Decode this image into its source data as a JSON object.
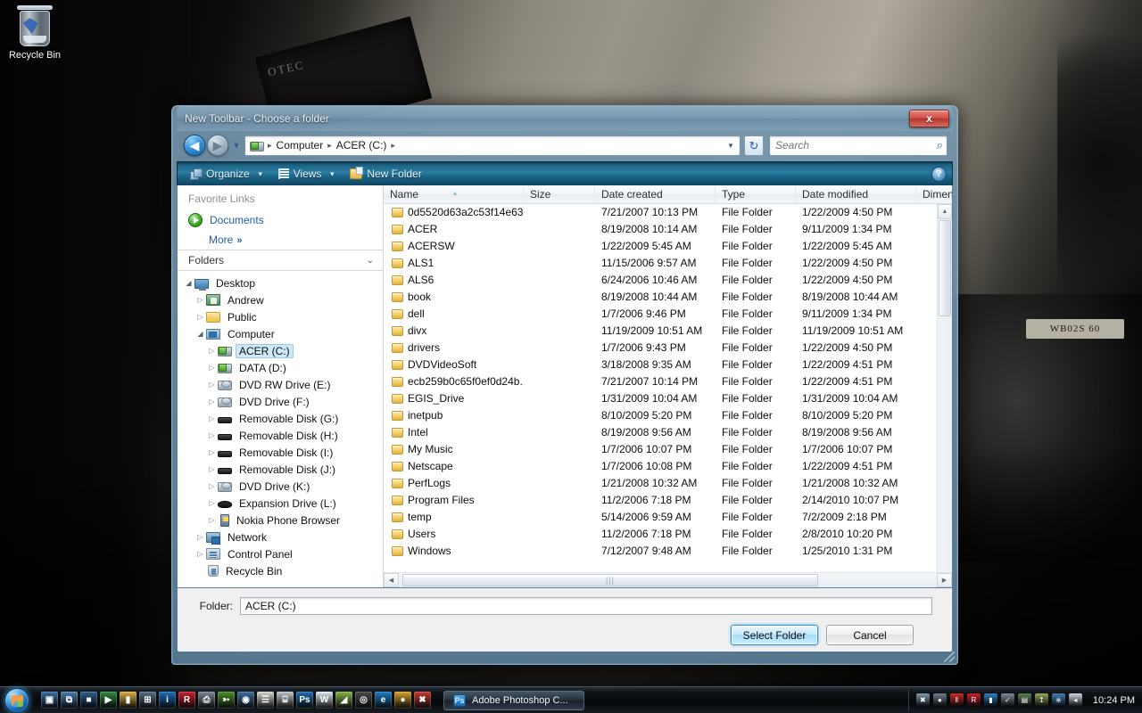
{
  "desktop": {
    "recycle_bin_label": "Recycle Bin",
    "wallpaper_plate_text": "WB02S 60",
    "wallpaper_sign_text": "OTEC"
  },
  "dialog": {
    "title": "New Toolbar - Choose a folder",
    "close_label": "x",
    "nav": {
      "back_icon": "◀",
      "forward_icon": "▶",
      "history_caret": "▼",
      "address_drive_icon": "hdd-icon",
      "breadcrumbs": [
        "Computer",
        "ACER (C:)"
      ],
      "breadcrumb_sep": "▸",
      "address_dropdown_caret": "▼",
      "refresh_icon": "↻",
      "search_placeholder": "Search",
      "search_value": "",
      "search_icon": "⌕"
    },
    "toolbar": {
      "organize_label": "Organize",
      "views_label": "Views",
      "new_folder_label": "New Folder",
      "caret": "▼",
      "help_label": "?"
    },
    "navpane": {
      "favorites_header": "Favorite Links",
      "favorites": [
        {
          "label": "Documents",
          "icon": "documents-green-icon"
        }
      ],
      "more_label": "More",
      "more_chevron": "»",
      "folders_header": "Folders",
      "folders_chevron": "⌄",
      "tree": [
        {
          "label": "Desktop",
          "depth": 0,
          "arrow": "open",
          "icon": "monitor-icon",
          "selected": false
        },
        {
          "label": "Andrew",
          "depth": 1,
          "arrow": "closed",
          "icon": "user-folder-icon",
          "selected": false
        },
        {
          "label": "Public",
          "depth": 1,
          "arrow": "closed",
          "icon": "folder-icon",
          "selected": false
        },
        {
          "label": "Computer",
          "depth": 1,
          "arrow": "open",
          "icon": "computer-icon",
          "selected": false
        },
        {
          "label": "ACER (C:)",
          "depth": 2,
          "arrow": "closed",
          "icon": "harddisk-icon",
          "selected": true
        },
        {
          "label": "DATA (D:)",
          "depth": 2,
          "arrow": "closed",
          "icon": "harddisk-icon",
          "selected": false
        },
        {
          "label": "DVD RW Drive (E:)",
          "depth": 2,
          "arrow": "closed",
          "icon": "dvd-drive-icon",
          "selected": false
        },
        {
          "label": "DVD Drive (F:)",
          "depth": 2,
          "arrow": "closed",
          "icon": "dvd-drive-icon",
          "selected": false
        },
        {
          "label": "Removable Disk (G:)",
          "depth": 2,
          "arrow": "closed",
          "icon": "removable-disk-icon",
          "selected": false
        },
        {
          "label": "Removable Disk (H:)",
          "depth": 2,
          "arrow": "closed",
          "icon": "removable-disk-icon",
          "selected": false
        },
        {
          "label": "Removable Disk (I:)",
          "depth": 2,
          "arrow": "closed",
          "icon": "removable-disk-icon",
          "selected": false
        },
        {
          "label": "Removable Disk (J:)",
          "depth": 2,
          "arrow": "closed",
          "icon": "removable-disk-icon",
          "selected": false
        },
        {
          "label": "DVD Drive (K:)",
          "depth": 2,
          "arrow": "closed",
          "icon": "dvd-drive-icon",
          "selected": false
        },
        {
          "label": "Expansion Drive (L:)",
          "depth": 2,
          "arrow": "closed",
          "icon": "expansion-drive-icon",
          "selected": false
        },
        {
          "label": "Nokia Phone Browser",
          "depth": 2,
          "arrow": "closed",
          "icon": "phone-icon",
          "selected": false
        },
        {
          "label": "Network",
          "depth": 1,
          "arrow": "closed",
          "icon": "network-icon",
          "selected": false
        },
        {
          "label": "Control Panel",
          "depth": 1,
          "arrow": "closed",
          "icon": "control-panel-icon",
          "selected": false
        },
        {
          "label": "Recycle Bin",
          "depth": 1,
          "arrow": "none",
          "icon": "recycle-bin-icon",
          "selected": false
        }
      ]
    },
    "filelist": {
      "columns": [
        {
          "label": "Name",
          "width": 157,
          "sorted": true
        },
        {
          "label": "Size",
          "width": 80,
          "sorted": false
        },
        {
          "label": "Date created",
          "width": 135,
          "sorted": false
        },
        {
          "label": "Type",
          "width": 90,
          "sorted": false
        },
        {
          "label": "Date modified",
          "width": 135,
          "sorted": false
        },
        {
          "label": "Dimen",
          "width": 45,
          "sorted": false
        }
      ],
      "sort_marker": "▴",
      "rows": [
        {
          "name": "0d5520d63a2c53f14e63...",
          "size": "",
          "created": "7/21/2007 10:13 PM",
          "type": "File Folder",
          "modified": "1/22/2009 4:50 PM",
          "dimensions": ""
        },
        {
          "name": "ACER",
          "size": "",
          "created": "8/19/2008 10:14 AM",
          "type": "File Folder",
          "modified": "9/11/2009 1:34 PM",
          "dimensions": ""
        },
        {
          "name": "ACERSW",
          "size": "",
          "created": "1/22/2009 5:45 AM",
          "type": "File Folder",
          "modified": "1/22/2009 5:45 AM",
          "dimensions": ""
        },
        {
          "name": "ALS1",
          "size": "",
          "created": "11/15/2006 9:57 AM",
          "type": "File Folder",
          "modified": "1/22/2009 4:50 PM",
          "dimensions": ""
        },
        {
          "name": "ALS6",
          "size": "",
          "created": "6/24/2006 10:46 AM",
          "type": "File Folder",
          "modified": "1/22/2009 4:50 PM",
          "dimensions": ""
        },
        {
          "name": "book",
          "size": "",
          "created": "8/19/2008 10:44 AM",
          "type": "File Folder",
          "modified": "8/19/2008 10:44 AM",
          "dimensions": ""
        },
        {
          "name": "dell",
          "size": "",
          "created": "1/7/2006 9:46 PM",
          "type": "File Folder",
          "modified": "9/11/2009 1:34 PM",
          "dimensions": ""
        },
        {
          "name": "divx",
          "size": "",
          "created": "11/19/2009 10:51 AM",
          "type": "File Folder",
          "modified": "11/19/2009 10:51 AM",
          "dimensions": ""
        },
        {
          "name": "drivers",
          "size": "",
          "created": "1/7/2006 9:43 PM",
          "type": "File Folder",
          "modified": "1/22/2009 4:50 PM",
          "dimensions": ""
        },
        {
          "name": "DVDVideoSoft",
          "size": "",
          "created": "3/18/2008 9:35 AM",
          "type": "File Folder",
          "modified": "1/22/2009 4:51 PM",
          "dimensions": ""
        },
        {
          "name": "ecb259b0c65f0ef0d24b...",
          "size": "",
          "created": "7/21/2007 10:14 PM",
          "type": "File Folder",
          "modified": "1/22/2009 4:51 PM",
          "dimensions": ""
        },
        {
          "name": "EGIS_Drive",
          "size": "",
          "created": "1/31/2009 10:04 AM",
          "type": "File Folder",
          "modified": "1/31/2009 10:04 AM",
          "dimensions": ""
        },
        {
          "name": "inetpub",
          "size": "",
          "created": "8/10/2009 5:20 PM",
          "type": "File Folder",
          "modified": "8/10/2009 5:20 PM",
          "dimensions": ""
        },
        {
          "name": "Intel",
          "size": "",
          "created": "8/19/2008 9:56 AM",
          "type": "File Folder",
          "modified": "8/19/2008 9:56 AM",
          "dimensions": ""
        },
        {
          "name": "My Music",
          "size": "",
          "created": "1/7/2006 10:07 PM",
          "type": "File Folder",
          "modified": "1/7/2006 10:07 PM",
          "dimensions": ""
        },
        {
          "name": "Netscape",
          "size": "",
          "created": "1/7/2006 10:08 PM",
          "type": "File Folder",
          "modified": "1/22/2009 4:51 PM",
          "dimensions": ""
        },
        {
          "name": "PerfLogs",
          "size": "",
          "created": "1/21/2008 10:32 AM",
          "type": "File Folder",
          "modified": "1/21/2008 10:32 AM",
          "dimensions": ""
        },
        {
          "name": "Program Files",
          "size": "",
          "created": "11/2/2006 7:18 PM",
          "type": "File Folder",
          "modified": "2/14/2010 10:07 PM",
          "dimensions": ""
        },
        {
          "name": "temp",
          "size": "",
          "created": "5/14/2006 9:59 AM",
          "type": "File Folder",
          "modified": "7/2/2009 2:18 PM",
          "dimensions": ""
        },
        {
          "name": "Users",
          "size": "",
          "created": "11/2/2006 7:18 PM",
          "type": "File Folder",
          "modified": "2/8/2010 10:20 PM",
          "dimensions": ""
        },
        {
          "name": "Windows",
          "size": "",
          "created": "7/12/2007 9:48 AM",
          "type": "File Folder",
          "modified": "1/25/2010 1:31 PM",
          "dimensions": ""
        }
      ],
      "hscroll_left_arrow": "◀",
      "hscroll_right_arrow": "▶",
      "hscroll_grip": "|||",
      "vscroll_up_arrow": "▲",
      "vscroll_down_arrow": "▼"
    },
    "footer": {
      "folder_label": "Folder:",
      "folder_value": "ACER (C:)",
      "select_folder_label": "Select Folder",
      "cancel_label": "Cancel"
    }
  },
  "taskbar": {
    "start_label": "Start",
    "quick_launch": [
      {
        "name": "show-desktop-icon",
        "color": "#3a6ea5",
        "glyph": "▣"
      },
      {
        "name": "switch-windows-icon",
        "color": "#4b7fae",
        "glyph": "⧉"
      },
      {
        "name": "media-center-icon",
        "color": "#2f5f8f",
        "glyph": "■"
      },
      {
        "name": "media-player-icon",
        "color": "#2e8b3e",
        "glyph": "▶"
      },
      {
        "name": "folder-icon",
        "color": "#e0b244",
        "glyph": "▮"
      },
      {
        "name": "calculator-icon",
        "color": "#5a6f86",
        "glyph": "⊞"
      },
      {
        "name": "info-icon",
        "color": "#1e6fb8",
        "glyph": "i"
      },
      {
        "name": "avira-icon",
        "color": "#cf1f2d",
        "glyph": "R"
      },
      {
        "name": "printer-icon",
        "color": "#7d8a95",
        "glyph": "⎙"
      },
      {
        "name": "nero-icon",
        "color": "#4e8f2b",
        "glyph": "➳"
      },
      {
        "name": "media-disc-icon",
        "color": "#3f6f9e",
        "glyph": "◉"
      },
      {
        "name": "notepad-icon",
        "color": "#d8d8d0",
        "glyph": "☰"
      },
      {
        "name": "spreadsheet-icon",
        "color": "#bfc6cd",
        "glyph": "⌸"
      },
      {
        "name": "photoshop-icon",
        "color": "#1f6fb4",
        "glyph": "Ps"
      },
      {
        "name": "word-icon",
        "color": "#e7edf3",
        "glyph": "W"
      },
      {
        "name": "picasa-icon",
        "color": "#87b544",
        "glyph": "◢"
      },
      {
        "name": "camera-icon",
        "color": "#4a4a4a",
        "glyph": "◎"
      },
      {
        "name": "internet-explorer-icon",
        "color": "#1b7fc4",
        "glyph": "e"
      },
      {
        "name": "chrome-icon",
        "color": "#d9a429",
        "glyph": "●"
      },
      {
        "name": "kaspersky-icon",
        "color": "#c83b2e",
        "glyph": "✖"
      }
    ],
    "task_button": {
      "label": "Adobe Photoshop C...",
      "icon_label": "Ps"
    },
    "tray": [
      {
        "name": "network-error-icon",
        "color": "#7f9bb0",
        "glyph": "✖"
      },
      {
        "name": "messenger-icon",
        "color": "#6e7d8a",
        "glyph": "●"
      },
      {
        "name": "bars-icon",
        "color": "#cf2a2a",
        "glyph": "‖"
      },
      {
        "name": "avira-tray-icon",
        "color": "#cf1f2d",
        "glyph": "R"
      },
      {
        "name": "battery-app-icon",
        "color": "#2f7fc4",
        "glyph": "▮"
      },
      {
        "name": "shield-ok-icon",
        "color": "#7c8b96",
        "glyph": "✓"
      },
      {
        "name": "hdd-tray-icon",
        "color": "#5a7f55",
        "glyph": "▤"
      },
      {
        "name": "safely-remove-icon",
        "color": "#8fa85a",
        "glyph": "↥"
      },
      {
        "name": "network-tray-icon",
        "color": "#3f7fb8",
        "glyph": "⎈"
      },
      {
        "name": "volume-icon",
        "color": "#cfd8e0",
        "glyph": "◂"
      }
    ],
    "clock": "10:24 PM"
  }
}
